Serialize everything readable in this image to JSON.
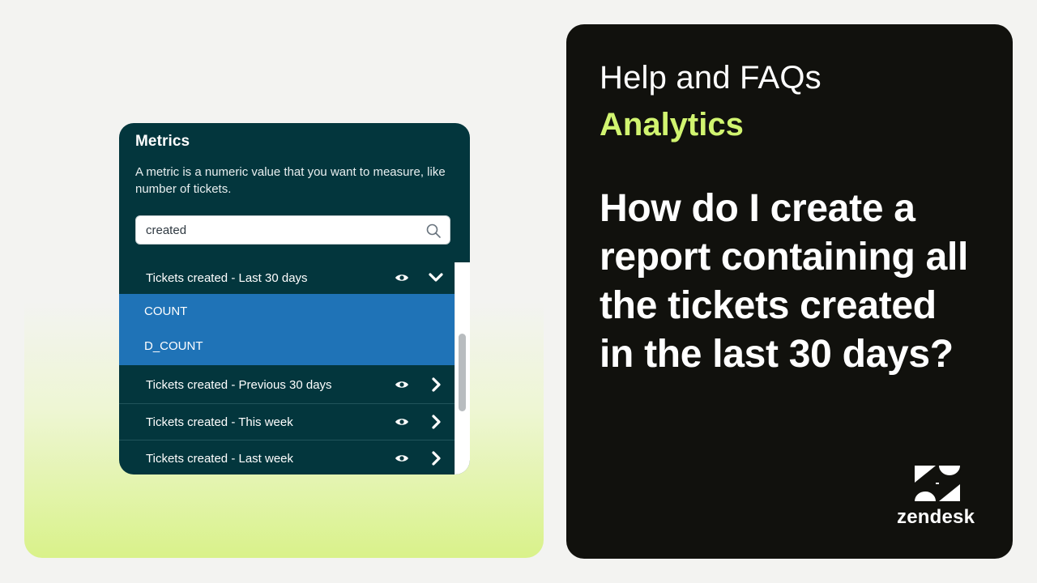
{
  "metrics": {
    "title": "Metrics",
    "description": "A metric is a numeric value that you want to measure, like number of tickets.",
    "search": {
      "value": "created",
      "placeholder": ""
    },
    "items": [
      {
        "label": "Tickets created - Last 30 days",
        "expanded": true,
        "aggregators": [
          "COUNT",
          "D_COUNT"
        ]
      },
      {
        "label": "Tickets created - Previous 30 days"
      },
      {
        "label": "Tickets created - This week"
      },
      {
        "label": "Tickets created - Last week"
      }
    ]
  },
  "card": {
    "section": "Help and FAQs",
    "subsection": "Analytics",
    "question": "How do I create a report containing all the tickets created in the last 30 days?"
  },
  "brand": {
    "name": "zendesk"
  },
  "colors": {
    "panel_dark": "#03363d",
    "selection_blue": "#1f73b7",
    "accent_green": "#d1f470",
    "card_black": "#11110d"
  },
  "icons": {
    "search": "search-icon",
    "eye": "eye-icon",
    "expand": "chevron-down-icon",
    "collapse": "chevron-right-icon",
    "logo": "zendesk-logo-icon"
  }
}
